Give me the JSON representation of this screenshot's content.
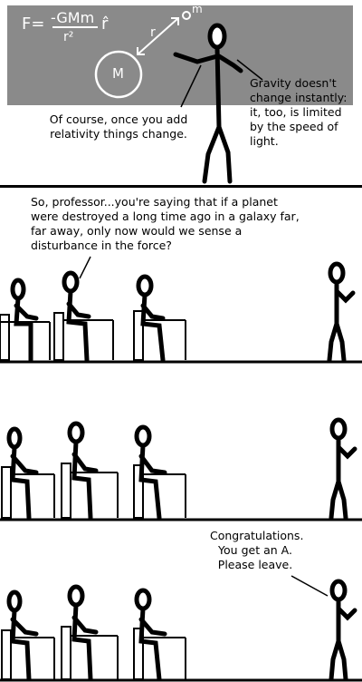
{
  "panel1": {
    "equation": {
      "lhs": "F=",
      "numerator": "-GMm",
      "denominator": "r²",
      "unit_vector": "r̂"
    },
    "mass_label": "M",
    "test_mass_label": "m",
    "distance_label": "r",
    "left_caption": "Of course, once you add relativity things change.",
    "right_caption": "Gravity doesn't change instantly: it, too, is limited by the speed of light."
  },
  "panel2": {
    "student_caption": "So, professor...you're saying that if a planet were destroyed a long time ago in a galaxy far, far away, only now would we sense a disturbance in the force?"
  },
  "panel3": {},
  "panel4": {
    "professor_caption": "Congratulations. You get an A. Please leave."
  },
  "colors": {
    "chalkboard": "#8a8a8a",
    "chalk": "#ffffff",
    "ink": "#000000"
  }
}
